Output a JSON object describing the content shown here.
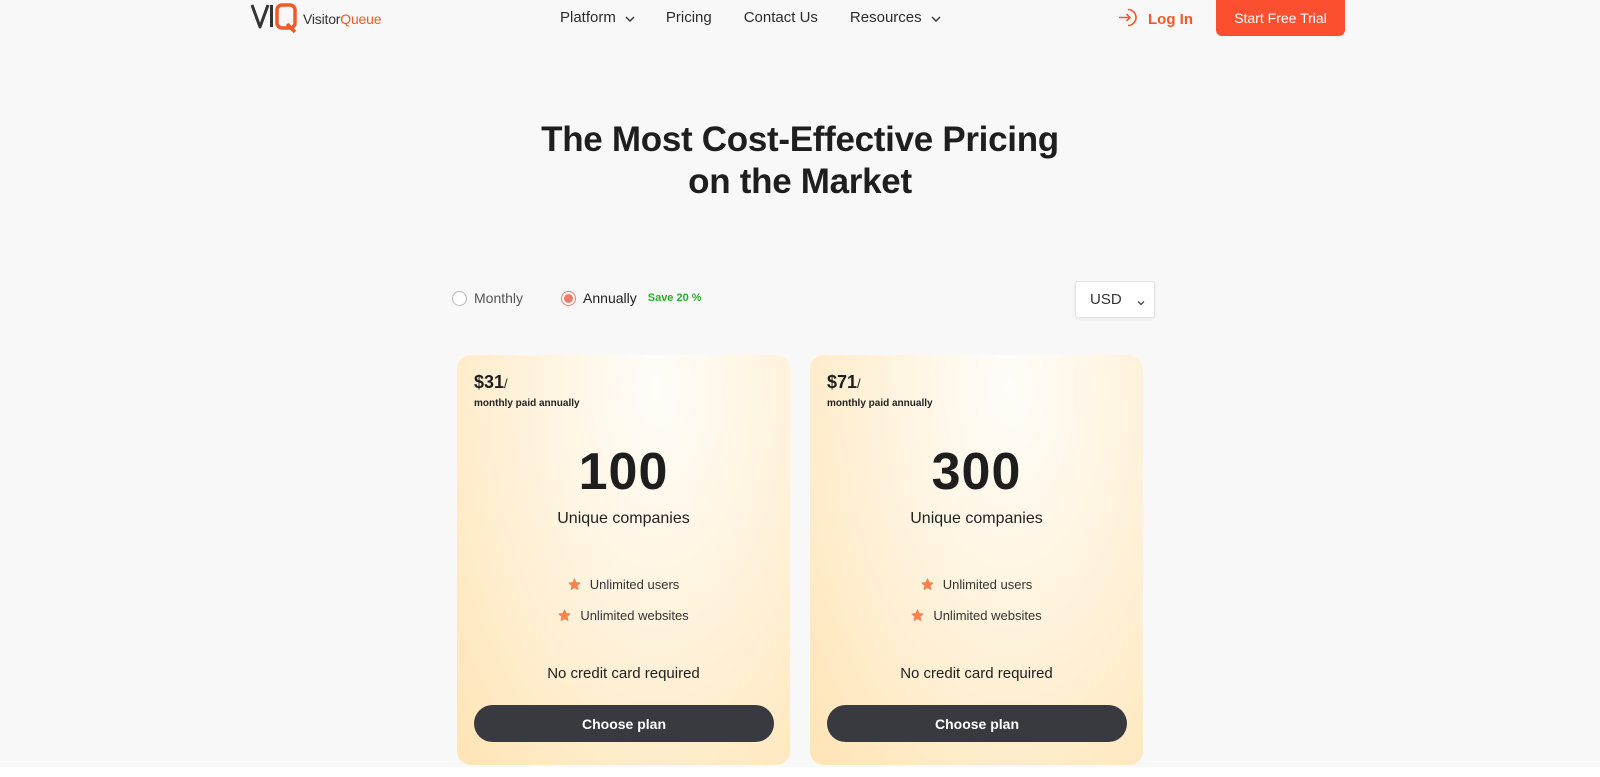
{
  "header": {
    "logo": {
      "brand_first": "Visitor",
      "brand_second": "Queue"
    },
    "nav": [
      {
        "label": "Platform",
        "has_dropdown": true
      },
      {
        "label": "Pricing",
        "has_dropdown": false
      },
      {
        "label": "Contact Us",
        "has_dropdown": false
      },
      {
        "label": "Resources",
        "has_dropdown": true
      }
    ],
    "login_label": "Log In",
    "cta_label": "Start Free Trial"
  },
  "hero": {
    "title_line1": "The Most Cost-Effective Pricing",
    "title_line2": "on the Market"
  },
  "billing": {
    "monthly_label": "Monthly",
    "annual_label": "Annually",
    "save_badge": "Save 20 %",
    "selected": "annually",
    "currency": "USD"
  },
  "plans": [
    {
      "price": "$31",
      "price_suffix": "/",
      "billing_note": "monthly paid annually",
      "count": "100",
      "count_label": "Unique companies",
      "features": [
        "Unlimited users",
        "Unlimited websites"
      ],
      "note": "No credit card required",
      "button_label": "Choose plan"
    },
    {
      "price": "$71",
      "price_suffix": "/",
      "billing_note": "monthly paid annually",
      "count": "300",
      "count_label": "Unique companies",
      "features": [
        "Unlimited users",
        "Unlimited websites"
      ],
      "note": "No credit card required",
      "button_label": "Choose plan"
    }
  ],
  "colors": {
    "accent": "#fb4f2f",
    "brand_orange": "#f05a28",
    "save_green": "#2eab2e",
    "button_dark": "#393a40",
    "star": "#f5844c"
  },
  "icons": [
    "vq-logo-icon",
    "chevron-down-icon",
    "login-arrow-icon",
    "star-icon"
  ]
}
